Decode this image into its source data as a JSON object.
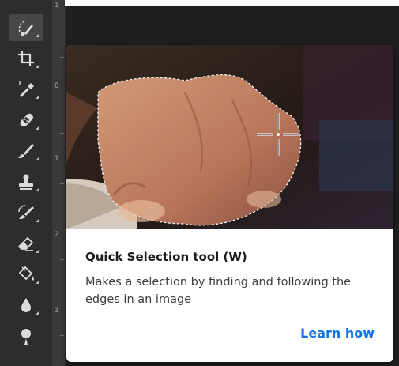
{
  "tools": [
    {
      "name": "quick-selection-tool",
      "icon": "quick-selection-icon",
      "active": true
    },
    {
      "name": "crop-tool",
      "icon": "crop-icon",
      "active": false
    },
    {
      "name": "eyedropper-tool",
      "icon": "eyedropper-icon",
      "active": false
    },
    {
      "name": "healing-brush-tool",
      "icon": "bandage-icon",
      "active": false
    },
    {
      "name": "brush-tool",
      "icon": "brush-icon",
      "active": false
    },
    {
      "name": "clone-stamp-tool",
      "icon": "stamp-icon",
      "active": false
    },
    {
      "name": "history-brush-tool",
      "icon": "history-brush-icon",
      "active": false
    },
    {
      "name": "eraser-tool",
      "icon": "eraser-icon",
      "active": false
    },
    {
      "name": "paint-bucket-tool",
      "icon": "paint-bucket-icon",
      "active": false
    },
    {
      "name": "blur-tool",
      "icon": "drop-icon",
      "active": false
    },
    {
      "name": "dodge-tool",
      "icon": "dodge-icon",
      "active": false
    }
  ],
  "ruler": {
    "labels": [
      "1",
      "0",
      "1",
      "2",
      "3"
    ]
  },
  "tooltip": {
    "title": "Quick Selection tool (W)",
    "description": "Makes a selection by finding and following the edges in an image",
    "link": "Learn how"
  },
  "colors": {
    "toolbar": "#2d2d2d",
    "active_tool": "#474747",
    "link": "#1473e6"
  }
}
